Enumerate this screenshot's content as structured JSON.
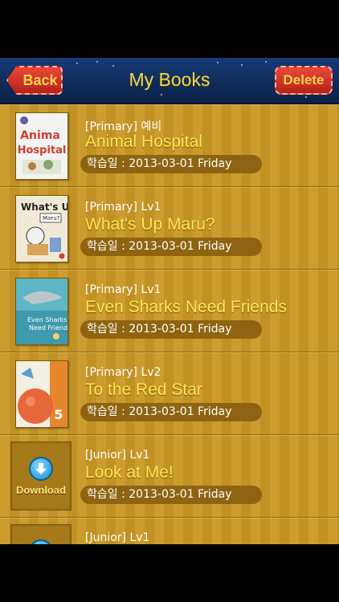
{
  "navbar": {
    "title": "My Books",
    "back_label": "Back",
    "delete_label": "Delete"
  },
  "books": [
    {
      "level": "[Primary] 예비",
      "title": "Animal Hospital",
      "date": "학습일 :  2013-03-01 Friday",
      "cover_text": "Animal Hospital",
      "cover_color": "#f3f3f1"
    },
    {
      "level": "[Primary] Lv1",
      "title": "What's Up Maru?",
      "date": "학습일 :  2013-03-01 Friday",
      "cover_text": "What's Up Maru?",
      "cover_color": "#e9e4d2"
    },
    {
      "level": "[Primary] Lv1",
      "title": "Even Sharks Need Friends",
      "date": "학습일 :  2013-03-01 Friday",
      "cover_text": "Even Sharks Need Friends",
      "cover_color": "#5fb6c4"
    },
    {
      "level": "[Primary] Lv2",
      "title": "To the Red Star",
      "date": "학습일 :  2013-03-01 Friday",
      "cover_text": "5",
      "cover_color": "#e7872c"
    },
    {
      "level": "[Junior] Lv1",
      "title": "Look at Me!",
      "date": "학습일 :  2013-03-01 Friday",
      "download_label": "Download"
    },
    {
      "level": "[Junior] Lv1",
      "title": "",
      "date": ""
    }
  ],
  "colors": {
    "navbar": "#0d2a57",
    "accent_yellow": "#ffe552",
    "button_red": "#c7301f",
    "wood": "#c99724"
  },
  "icons": {
    "back": "back-arrow-button",
    "download": "download-arrow-icon"
  }
}
